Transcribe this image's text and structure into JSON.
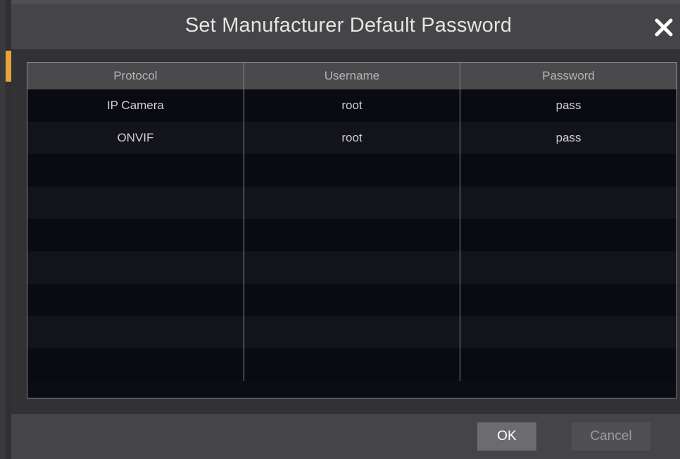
{
  "dialog": {
    "title": "Set Manufacturer Default Password",
    "close_icon": "close-icon"
  },
  "table": {
    "columns": [
      "Protocol",
      "Username",
      "Password"
    ],
    "rows": [
      [
        "IP Camera",
        "root",
        "pass"
      ],
      [
        "ONVIF",
        "root",
        "pass"
      ],
      [
        "",
        "",
        ""
      ],
      [
        "",
        "",
        ""
      ],
      [
        "",
        "",
        ""
      ],
      [
        "",
        "",
        ""
      ],
      [
        "",
        "",
        ""
      ],
      [
        "",
        "",
        ""
      ],
      [
        "",
        "",
        ""
      ]
    ]
  },
  "footer": {
    "ok_label": "OK",
    "cancel_label": "Cancel"
  },
  "colors": {
    "accent": "#e8a33a",
    "title_bar": "#454548",
    "table_bg": "#0c0c14"
  }
}
